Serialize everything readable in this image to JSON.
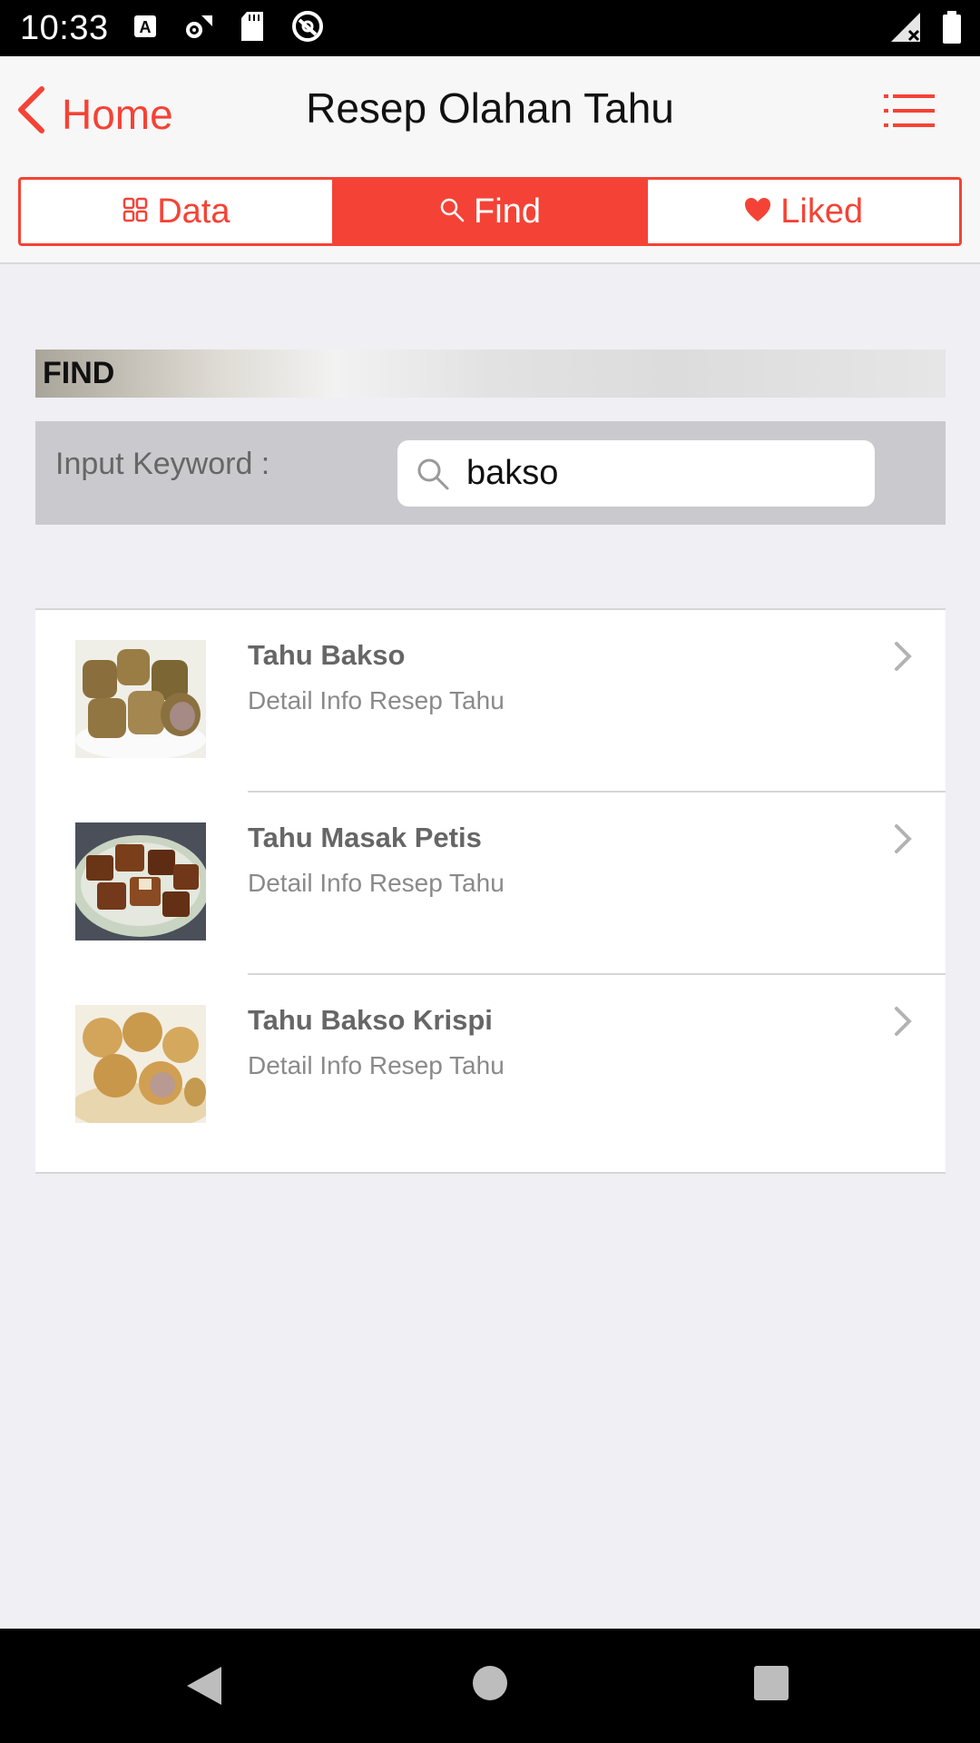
{
  "status_bar": {
    "time": "10:33",
    "icons_left": [
      "a-icon",
      "settings-network-icon",
      "sd-card-icon",
      "data-saver-icon"
    ],
    "icons_right": [
      "cell-signal-off-icon",
      "battery-icon"
    ]
  },
  "nav": {
    "back_label": "Home",
    "title": "Resep Olahan Tahu",
    "menu_icon": "list-icon",
    "accent_color": "#f44336"
  },
  "tabs": [
    {
      "label": "Data",
      "icon": "grid-icon",
      "active": false
    },
    {
      "label": "Find",
      "icon": "search-icon",
      "active": true
    },
    {
      "label": "Liked",
      "icon": "heart-icon",
      "active": false
    }
  ],
  "find": {
    "header": "FIND",
    "keyword_label": "Input Keyword :",
    "keyword_value": "bakso"
  },
  "results": [
    {
      "title": "Tahu Bakso",
      "subtitle": "Detail Info Resep Tahu"
    },
    {
      "title": "Tahu Masak Petis",
      "subtitle": "Detail Info Resep Tahu"
    },
    {
      "title": "Tahu Bakso Krispi",
      "subtitle": "Detail Info Resep Tahu"
    }
  ],
  "system_nav": [
    "back-icon",
    "home-icon",
    "recents-icon"
  ]
}
